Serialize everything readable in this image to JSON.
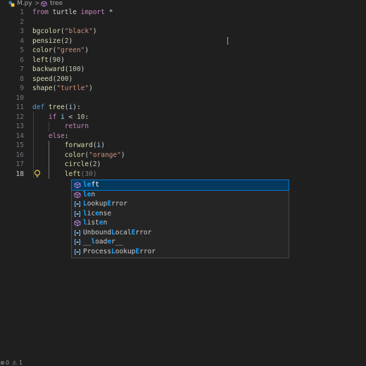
{
  "breadcrumb": {
    "file": "M.py",
    "separator": ">",
    "symbol": "tree"
  },
  "editor": {
    "active_line": 18,
    "line_numbers": [
      "1",
      "2",
      "3",
      "4",
      "5",
      "6",
      "7",
      "8",
      "9",
      "10",
      "11",
      "12",
      "13",
      "14",
      "15",
      "16",
      "17",
      "18"
    ],
    "lines": [
      "from turtle import *",
      "",
      "bgcolor(\"black\")",
      "pensize(2)",
      "color(\"green\")",
      "left(90)",
      "backward(100)",
      "speed(200)",
      "shape(\"turtle\")",
      "",
      "def tree(i):",
      "    if i < 10:",
      "        return",
      "    else:",
      "        forward(i)",
      "        color(\"orange\")",
      "        circle(2)",
      "        left(30)"
    ]
  },
  "suggestions": {
    "typed_prefix": "le",
    "items": [
      {
        "label": "left",
        "kind": "function",
        "selected": true
      },
      {
        "label": "len",
        "kind": "function",
        "selected": false
      },
      {
        "label": "LookupError",
        "kind": "variable",
        "selected": false
      },
      {
        "label": "license",
        "kind": "variable",
        "selected": false
      },
      {
        "label": "listen",
        "kind": "function",
        "selected": false
      },
      {
        "label": "UnboundLocalError",
        "kind": "variable",
        "selected": false
      },
      {
        "label": "__loader__",
        "kind": "variable",
        "selected": false
      },
      {
        "label": "ProcessLookupError",
        "kind": "variable",
        "selected": false
      }
    ]
  },
  "status": {
    "errors": "0",
    "warnings": "1"
  },
  "colors": {
    "background": "#1f1f1f",
    "selection": "#04395e",
    "match": "#18a3ff"
  }
}
